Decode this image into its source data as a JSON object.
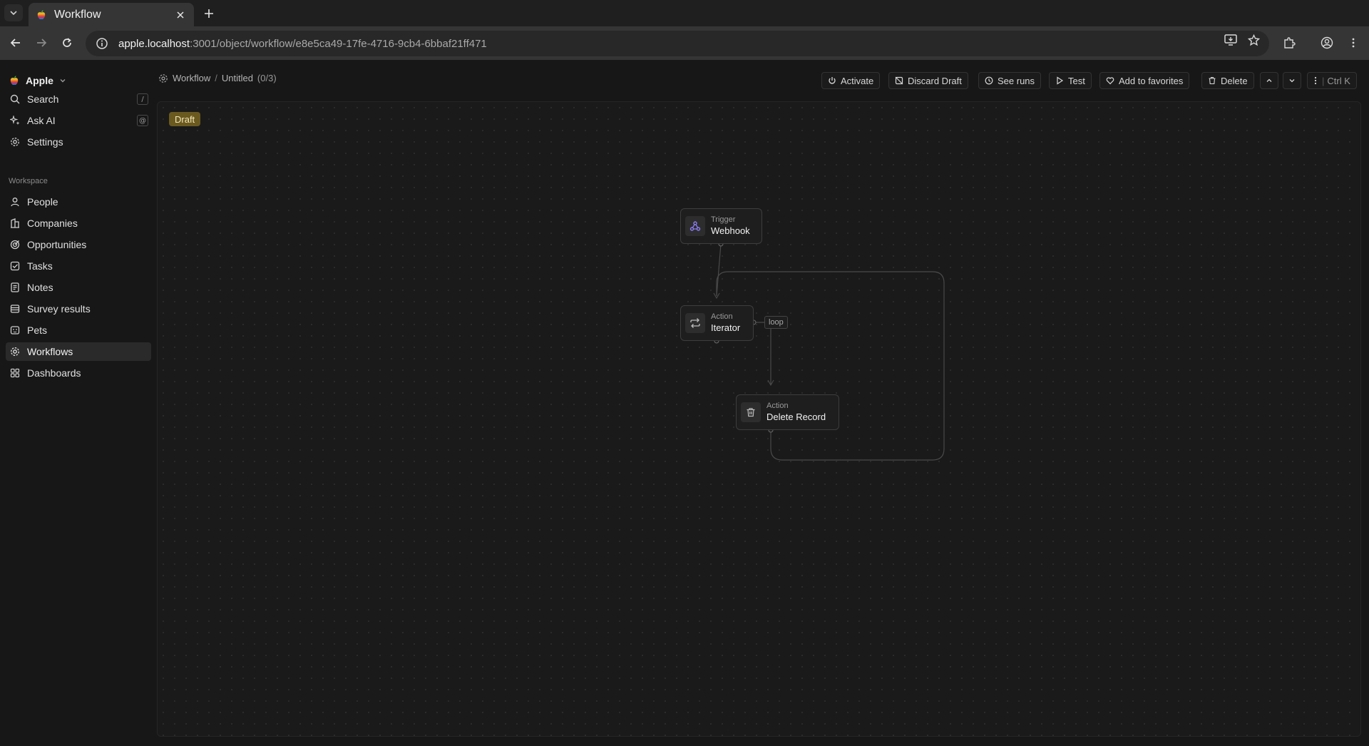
{
  "browser": {
    "tab_title": "Workflow",
    "url_host": "apple.localhost",
    "url_rest": ":3001/object/workflow/e8e5ca49-17fe-4716-9cb4-6bbaf21ff471"
  },
  "sidebar": {
    "workspace_name": "Apple",
    "top_items": [
      {
        "label": "Search",
        "shortcut": "/",
        "icon": "search-icon"
      },
      {
        "label": "Ask AI",
        "shortcut": "@",
        "icon": "sparkles-icon"
      },
      {
        "label": "Settings",
        "icon": "gear-icon"
      }
    ],
    "section_label": "Workspace",
    "items": [
      {
        "label": "People",
        "icon": "user-icon"
      },
      {
        "label": "Companies",
        "icon": "building-icon"
      },
      {
        "label": "Opportunities",
        "icon": "target-icon"
      },
      {
        "label": "Tasks",
        "icon": "checkbox-icon"
      },
      {
        "label": "Notes",
        "icon": "notes-icon"
      },
      {
        "label": "Survey results",
        "icon": "table-icon"
      },
      {
        "label": "Pets",
        "icon": "paw-icon"
      },
      {
        "label": "Workflows",
        "icon": "workflow-icon",
        "active": true
      },
      {
        "label": "Dashboards",
        "icon": "dashboard-icon"
      }
    ]
  },
  "header": {
    "breadcrumb_parent": "Workflow",
    "breadcrumb_separator": "/",
    "breadcrumb_title": "Untitled",
    "breadcrumb_count": "(0/3)",
    "actions": {
      "activate": "Activate",
      "discard_draft": "Discard Draft",
      "see_runs": "See runs",
      "test": "Test",
      "add_to_favorites": "Add to favorites",
      "delete": "Delete",
      "command_shortcut": "Ctrl K"
    }
  },
  "canvas": {
    "status_badge": "Draft",
    "nodes": [
      {
        "type": "Trigger",
        "name": "Webhook",
        "icon": "webhook-icon"
      },
      {
        "type": "Action",
        "name": "Iterator",
        "icon": "repeat-icon"
      },
      {
        "type": "Action",
        "name": "Delete Record",
        "icon": "trash-icon"
      }
    ],
    "loop_label": "loop"
  },
  "colors": {
    "draft_badge_bg": "#6b5a20",
    "webhook_icon": "#8b7cf6"
  }
}
